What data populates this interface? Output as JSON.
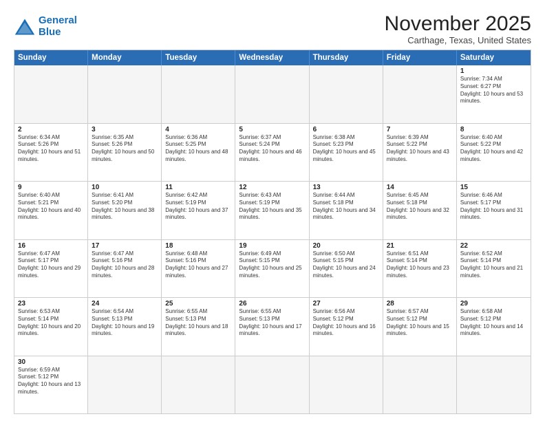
{
  "logo": {
    "line1": "General",
    "line2": "Blue"
  },
  "title": "November 2025",
  "subtitle": "Carthage, Texas, United States",
  "header_days": [
    "Sunday",
    "Monday",
    "Tuesday",
    "Wednesday",
    "Thursday",
    "Friday",
    "Saturday"
  ],
  "weeks": [
    [
      {
        "day": "",
        "info": ""
      },
      {
        "day": "",
        "info": ""
      },
      {
        "day": "",
        "info": ""
      },
      {
        "day": "",
        "info": ""
      },
      {
        "day": "",
        "info": ""
      },
      {
        "day": "",
        "info": ""
      },
      {
        "day": "1",
        "info": "Sunrise: 7:34 AM\nSunset: 6:27 PM\nDaylight: 10 hours and 53 minutes."
      }
    ],
    [
      {
        "day": "2",
        "info": "Sunrise: 6:34 AM\nSunset: 5:26 PM\nDaylight: 10 hours and 51 minutes."
      },
      {
        "day": "3",
        "info": "Sunrise: 6:35 AM\nSunset: 5:26 PM\nDaylight: 10 hours and 50 minutes."
      },
      {
        "day": "4",
        "info": "Sunrise: 6:36 AM\nSunset: 5:25 PM\nDaylight: 10 hours and 48 minutes."
      },
      {
        "day": "5",
        "info": "Sunrise: 6:37 AM\nSunset: 5:24 PM\nDaylight: 10 hours and 46 minutes."
      },
      {
        "day": "6",
        "info": "Sunrise: 6:38 AM\nSunset: 5:23 PM\nDaylight: 10 hours and 45 minutes."
      },
      {
        "day": "7",
        "info": "Sunrise: 6:39 AM\nSunset: 5:22 PM\nDaylight: 10 hours and 43 minutes."
      },
      {
        "day": "8",
        "info": "Sunrise: 6:40 AM\nSunset: 5:22 PM\nDaylight: 10 hours and 42 minutes."
      }
    ],
    [
      {
        "day": "9",
        "info": "Sunrise: 6:40 AM\nSunset: 5:21 PM\nDaylight: 10 hours and 40 minutes."
      },
      {
        "day": "10",
        "info": "Sunrise: 6:41 AM\nSunset: 5:20 PM\nDaylight: 10 hours and 38 minutes."
      },
      {
        "day": "11",
        "info": "Sunrise: 6:42 AM\nSunset: 5:19 PM\nDaylight: 10 hours and 37 minutes."
      },
      {
        "day": "12",
        "info": "Sunrise: 6:43 AM\nSunset: 5:19 PM\nDaylight: 10 hours and 35 minutes."
      },
      {
        "day": "13",
        "info": "Sunrise: 6:44 AM\nSunset: 5:18 PM\nDaylight: 10 hours and 34 minutes."
      },
      {
        "day": "14",
        "info": "Sunrise: 6:45 AM\nSunset: 5:18 PM\nDaylight: 10 hours and 32 minutes."
      },
      {
        "day": "15",
        "info": "Sunrise: 6:46 AM\nSunset: 5:17 PM\nDaylight: 10 hours and 31 minutes."
      }
    ],
    [
      {
        "day": "16",
        "info": "Sunrise: 6:47 AM\nSunset: 5:17 PM\nDaylight: 10 hours and 29 minutes."
      },
      {
        "day": "17",
        "info": "Sunrise: 6:47 AM\nSunset: 5:16 PM\nDaylight: 10 hours and 28 minutes."
      },
      {
        "day": "18",
        "info": "Sunrise: 6:48 AM\nSunset: 5:16 PM\nDaylight: 10 hours and 27 minutes."
      },
      {
        "day": "19",
        "info": "Sunrise: 6:49 AM\nSunset: 5:15 PM\nDaylight: 10 hours and 25 minutes."
      },
      {
        "day": "20",
        "info": "Sunrise: 6:50 AM\nSunset: 5:15 PM\nDaylight: 10 hours and 24 minutes."
      },
      {
        "day": "21",
        "info": "Sunrise: 6:51 AM\nSunset: 5:14 PM\nDaylight: 10 hours and 23 minutes."
      },
      {
        "day": "22",
        "info": "Sunrise: 6:52 AM\nSunset: 5:14 PM\nDaylight: 10 hours and 21 minutes."
      }
    ],
    [
      {
        "day": "23",
        "info": "Sunrise: 6:53 AM\nSunset: 5:14 PM\nDaylight: 10 hours and 20 minutes."
      },
      {
        "day": "24",
        "info": "Sunrise: 6:54 AM\nSunset: 5:13 PM\nDaylight: 10 hours and 19 minutes."
      },
      {
        "day": "25",
        "info": "Sunrise: 6:55 AM\nSunset: 5:13 PM\nDaylight: 10 hours and 18 minutes."
      },
      {
        "day": "26",
        "info": "Sunrise: 6:55 AM\nSunset: 5:13 PM\nDaylight: 10 hours and 17 minutes."
      },
      {
        "day": "27",
        "info": "Sunrise: 6:56 AM\nSunset: 5:12 PM\nDaylight: 10 hours and 16 minutes."
      },
      {
        "day": "28",
        "info": "Sunrise: 6:57 AM\nSunset: 5:12 PM\nDaylight: 10 hours and 15 minutes."
      },
      {
        "day": "29",
        "info": "Sunrise: 6:58 AM\nSunset: 5:12 PM\nDaylight: 10 hours and 14 minutes."
      }
    ],
    [
      {
        "day": "30",
        "info": "Sunrise: 6:59 AM\nSunset: 5:12 PM\nDaylight: 10 hours and 13 minutes."
      },
      {
        "day": "",
        "info": ""
      },
      {
        "day": "",
        "info": ""
      },
      {
        "day": "",
        "info": ""
      },
      {
        "day": "",
        "info": ""
      },
      {
        "day": "",
        "info": ""
      },
      {
        "day": "",
        "info": ""
      }
    ]
  ]
}
